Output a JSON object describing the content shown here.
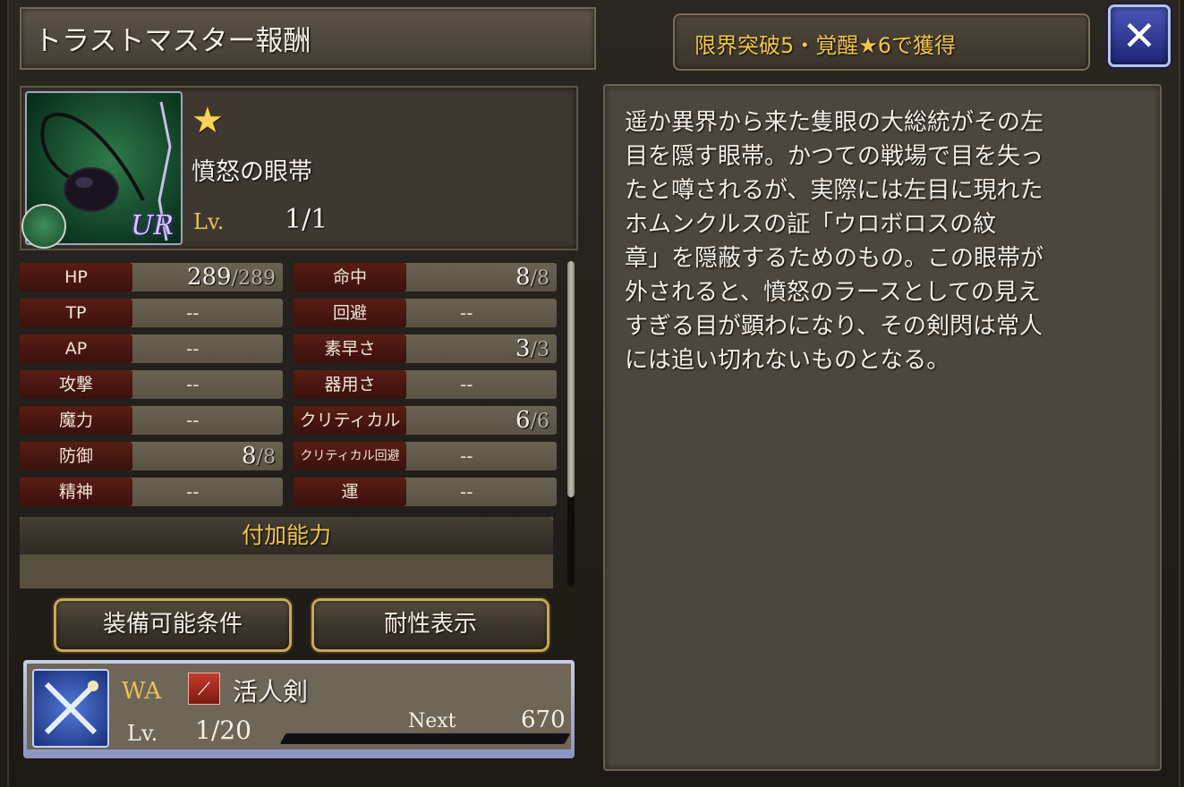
{
  "title": "トラストマスター報酬",
  "unlock_condition": "限界突破5・覚醒★6で獲得",
  "close_label": "✕",
  "item": {
    "icon": "eyepatch-icon",
    "rarity_badge": "UR",
    "star": "★",
    "name": "憤怒の眼帯",
    "lv_label": "Lv.",
    "lv_value": "1/1"
  },
  "stats": [
    {
      "label": "HP",
      "value": "289",
      "max": "/289"
    },
    {
      "label": "命中",
      "value": "8",
      "max": "/8"
    },
    {
      "label": "TP",
      "dash": "--"
    },
    {
      "label": "回避",
      "dash": "--"
    },
    {
      "label": "AP",
      "dash": "--"
    },
    {
      "label": "素早さ",
      "value": "3",
      "max": "/3"
    },
    {
      "label": "攻撃",
      "dash": "--"
    },
    {
      "label": "器用さ",
      "dash": "--"
    },
    {
      "label": "魔力",
      "dash": "--"
    },
    {
      "label": "クリティカル",
      "value": "6",
      "max": "/6"
    },
    {
      "label": "防御",
      "value": "8",
      "max": "/8"
    },
    {
      "label": "クリティカル回避",
      "dash": "--"
    },
    {
      "label": "精神",
      "dash": "--"
    },
    {
      "label": "運",
      "dash": "--"
    }
  ],
  "ability_header": "付加能力",
  "buttons": {
    "equip_conditions": "装備可能条件",
    "resistance": "耐性表示"
  },
  "weapon_ability": {
    "tag": "WA",
    "name": "活人剣",
    "lv_label": "Lv.",
    "lv_value": "1/20",
    "next_label": "Next",
    "next_value": "670"
  },
  "description": "遥か異界から来た隻眼の大総統がその左\n目を隠す眼帯。かつての戦場で目を失っ\nたと噂されるが、実際には左目に現れた\nホムンクルスの証「ウロボロスの紋\n章」を隠蔽するためのもの。この眼帯が\n外されると、憤怒のラースとしての見え\nすぎる目が顕わになり、その剣閃は常人\nには追い切れないものとなる。"
}
